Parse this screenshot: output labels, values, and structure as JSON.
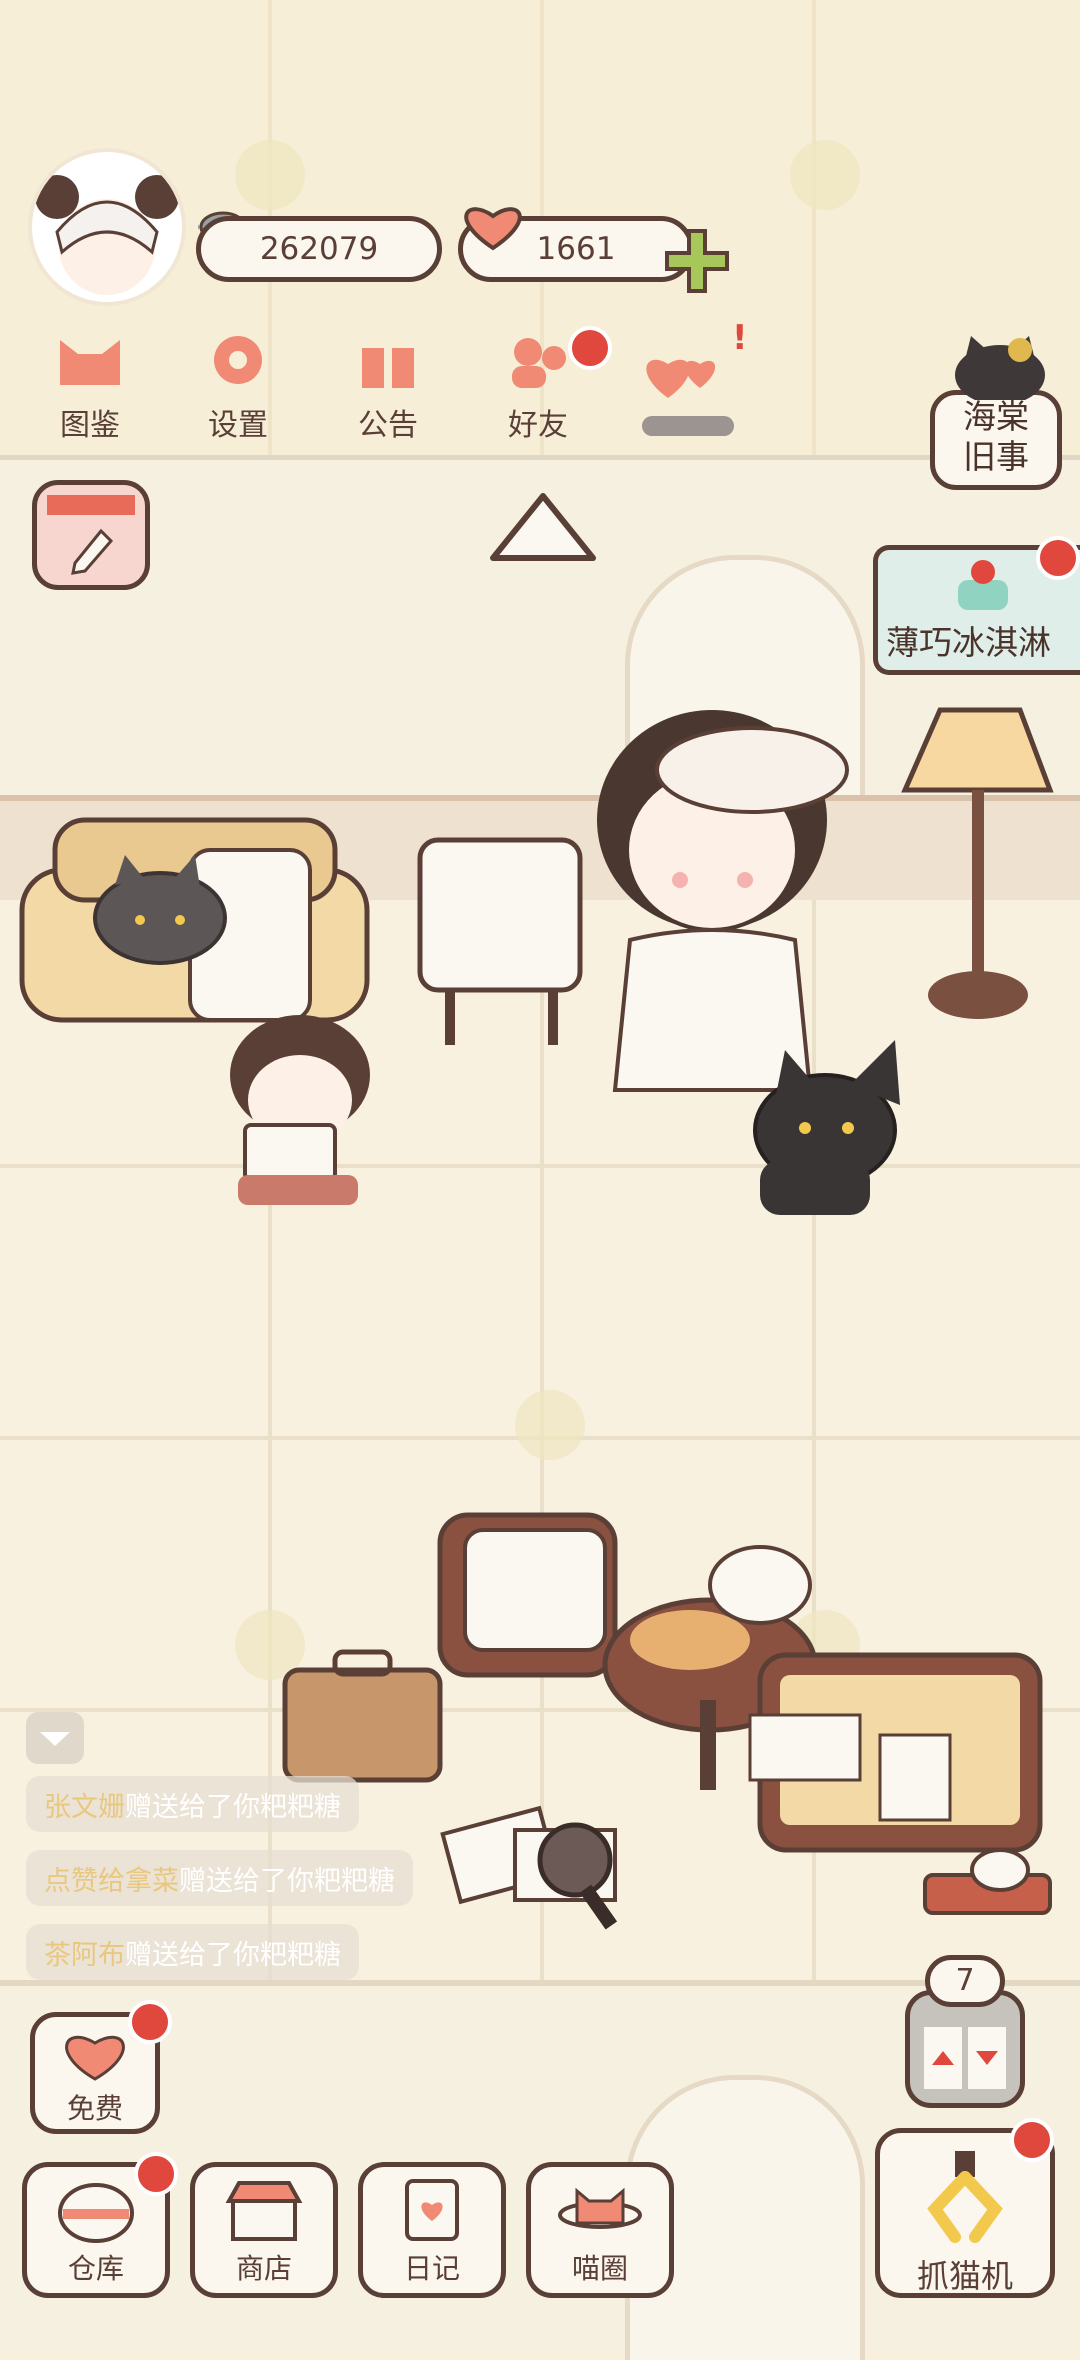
{
  "profile": {
    "fish_count": "262079",
    "heart_count": "1661"
  },
  "top_menu": [
    {
      "label": "图鉴"
    },
    {
      "label": "设置"
    },
    {
      "label": "公告"
    },
    {
      "label": "好友"
    }
  ],
  "event_banner": {
    "title": "海棠\n旧事"
  },
  "promo_banner": {
    "title": "薄巧冰淇淋"
  },
  "chat_feed": [
    {
      "sender": "张文姗",
      "message": "赠送给了你粑粑糖"
    },
    {
      "sender": "点赞给拿菜",
      "message": "赠送给了你粑粑糖"
    },
    {
      "sender": "茶阿布",
      "message": "赠送给了你粑粑糖"
    }
  ],
  "elevator": {
    "floor": "7"
  },
  "bottom_bar": {
    "free": "免费",
    "warehouse": "仓库",
    "shop": "商店",
    "diary": "日记",
    "cat_circle": "喵圈",
    "claw_machine": "抓猫机"
  },
  "colors": {
    "accent_red": "#e0483e",
    "outline": "#5a3f36",
    "coral": "#f08a74"
  }
}
